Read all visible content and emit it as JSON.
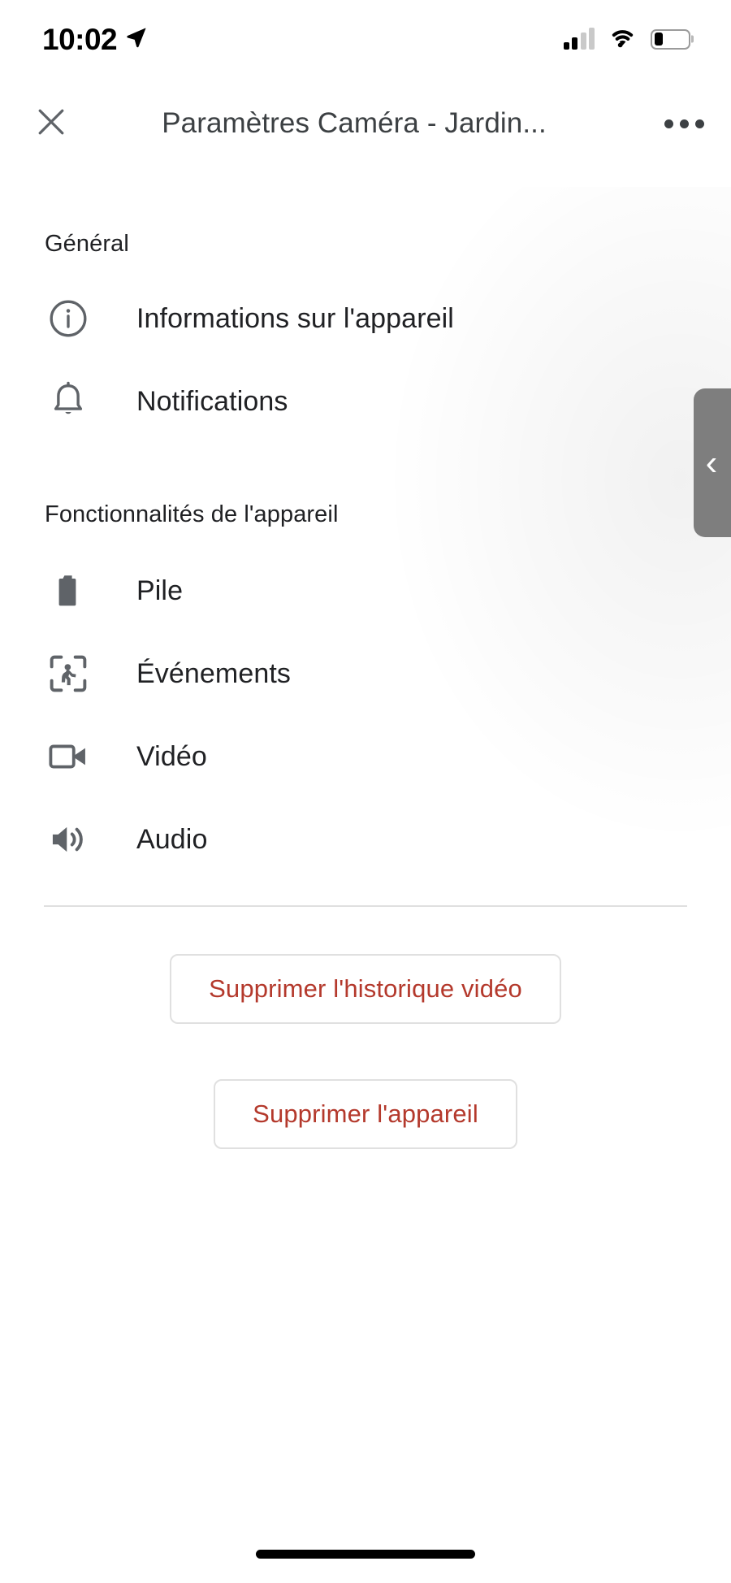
{
  "status_bar": {
    "time": "10:02",
    "location_icon": "location-arrow-icon",
    "cellular_icon": "cellular-signal-icon",
    "cellular_bars_filled": 2,
    "cellular_bars_total": 4,
    "wifi_icon": "wifi-icon",
    "battery_icon": "battery-icon",
    "battery_percent": 25
  },
  "app_bar": {
    "close_icon": "close-icon",
    "title": "Paramètres Caméra - Jardin...",
    "overflow_icon": "more-options-icon"
  },
  "sections": [
    {
      "id": "general",
      "header": "Général",
      "items": [
        {
          "icon": "info-circle-icon",
          "label": "Informations sur l'appareil"
        },
        {
          "icon": "bell-icon",
          "label": "Notifications"
        }
      ]
    },
    {
      "id": "device_features",
      "header": "Fonctionnalités de l'appareil",
      "items": [
        {
          "icon": "battery-full-icon",
          "label": "Pile"
        },
        {
          "icon": "person-in-frame-icon",
          "label": "Événements"
        },
        {
          "icon": "video-camera-icon",
          "label": "Vidéo"
        },
        {
          "icon": "speaker-volume-icon",
          "label": "Audio"
        }
      ]
    }
  ],
  "actions": {
    "delete_video_history": "Supprimer l'historique vidéo",
    "delete_device": "Supprimer l'appareil",
    "destructive_color": "#b4392c",
    "button_border_color": "#e0e0e0"
  },
  "side_tab": {
    "chevron": "‹",
    "icon": "chevron-left-icon",
    "color": "#7e7e7e"
  },
  "home_indicator": {
    "icon": "home-indicator-bar"
  }
}
